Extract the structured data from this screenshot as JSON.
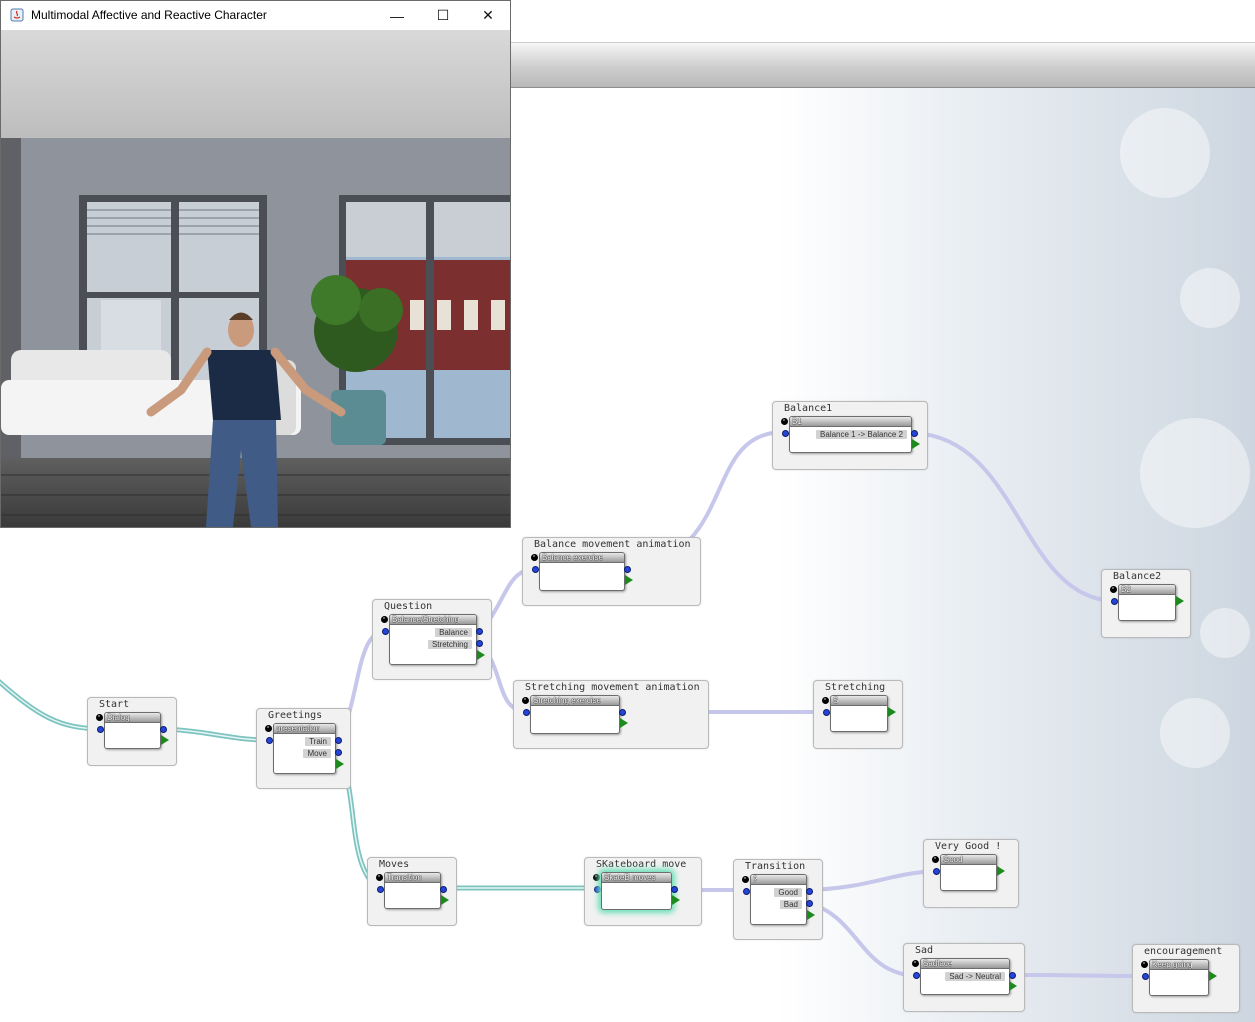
{
  "window": {
    "title": "Multimodal Affective and Reactive Character",
    "controls": {
      "minimize": "—",
      "maximize": "☐",
      "close": "✕"
    }
  },
  "nodes": [
    {
      "id": "start",
      "title": "Start",
      "inner_name": "Dialog",
      "outputs": []
    },
    {
      "id": "greetings",
      "title": "Greetings",
      "inner_name": "presentation",
      "outputs": [
        "Train",
        "Move"
      ]
    },
    {
      "id": "question",
      "title": "Question",
      "inner_name": "Balance/Stretching",
      "outputs": [
        "Balance",
        "Stretching"
      ]
    },
    {
      "id": "balance-anim",
      "title": "Balance movement animation",
      "inner_name": "Balance exercise",
      "outputs": []
    },
    {
      "id": "stretching-anim",
      "title": "Stretching movement animation",
      "inner_name": "Stretching exercise",
      "outputs": []
    },
    {
      "id": "balance1",
      "title": "Balance1",
      "inner_name": "B1",
      "outputs": [
        "Balance 1 -> Balance 2"
      ]
    },
    {
      "id": "balance2",
      "title": "Balance2",
      "inner_name": "B2",
      "outputs": []
    },
    {
      "id": "stretching",
      "title": "Stretching",
      "inner_name": "S",
      "outputs": []
    },
    {
      "id": "moves",
      "title": "Moves",
      "inner_name": "Transition",
      "outputs": []
    },
    {
      "id": "skate",
      "title": "SKateboard move",
      "inner_name": "SkateB moves",
      "outputs": []
    },
    {
      "id": "transition",
      "title": "Transition",
      "inner_name": "?",
      "outputs": [
        "Good",
        "Bad"
      ]
    },
    {
      "id": "verygood",
      "title": "Very Good !",
      "inner_name": "Good",
      "outputs": []
    },
    {
      "id": "sad",
      "title": "Sad",
      "inner_name": "Sadface",
      "outputs": [
        "Sad -> Neutral"
      ]
    },
    {
      "id": "encouragement",
      "title": "encouragement",
      "inner_name": "Keep going",
      "outputs": []
    }
  ]
}
